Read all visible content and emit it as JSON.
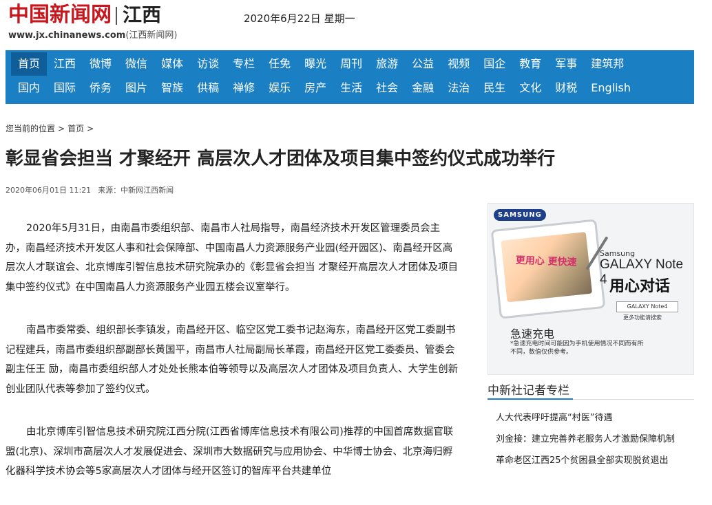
{
  "header": {
    "logo_text": "中国新闻网",
    "region": "江西",
    "url_domain": "www.jx.chinanews.com",
    "url_suffix": "(江西新闻网)",
    "date": "2020年6月22日",
    "weekday": "星期一"
  },
  "nav": {
    "row1": [
      "首页",
      "江西",
      "微博",
      "微信",
      "媒体",
      "访谈",
      "专栏",
      "任免",
      "曝光",
      "周刊",
      "旅游",
      "公益",
      "视频",
      "国企",
      "教育",
      "军事",
      "建筑邦"
    ],
    "row2": [
      "国内",
      "国际",
      "侨务",
      "图片",
      "智族",
      "供稿",
      "禅修",
      "娱乐",
      "房产",
      "生活",
      "社会",
      "金融",
      "法治",
      "民生",
      "文化",
      "财税",
      "English"
    ],
    "active": "首页",
    "colors": {
      "bar": "#1b7fc4",
      "active": "#0f5d99"
    }
  },
  "breadcrumb": {
    "prefix": "您当前的位置",
    "sep": ">",
    "home": "首页",
    "sep2": ">"
  },
  "article": {
    "title": "彰显省会担当 才聚经开 高层次人才团体及项目集中签约仪式成功举行",
    "datetime": "2020年06月01日 11:21",
    "source": "来源：中新网江西新闻",
    "paragraphs": [
      "2020年5月31日，由南昌市委组织部、南昌市人社局指导，南昌经济技术开发区管理委员会主办，南昌经济技术开发区人事和社会保障部、中国南昌人力资源服务产业园(经开园区)、南昌经开区高层次人才联谊会、北京博库引智信息技术研究院承办的《彰显省会担当 才聚经开高层次人才团体及项目集中签约仪式》在中国南昌人力资源服务产业园五楼会议室举行。",
      "南昌市委常委、组织部长李镇发，南昌经开区、临空区党工委书记赵海东，南昌经开区党工委副书记程建兵，南昌市委组织部副部长黄国平，南昌市人社局副局长革霞，南昌经开区党工委委员、管委会副主任王 励，南昌市委组织部人才处处长熊本伯等领导以及高层次人才团体及项目负责人、大学生创新创业团队代表等参加了签约仪式。",
      "由北京博库引智信息技术研究院江西分院(江西省博库信息技术有限公司)推荐的中国首席数据官联盟(北京)、深圳市高层次人才发展促进会、深圳市大数据研究与应用协会、中华博士协会、北京海归孵化器科学技术协会等5家高层次人才团体与经开区签订的智库平台共建单位"
    ]
  },
  "ad": {
    "brand": "SAMSUNG",
    "screen_text": "更用心 更快速",
    "model_line1": "Samsung",
    "model_line2": "GALAXY Note 4",
    "slogan": "用心对话",
    "box_label": "GALAXY Note4",
    "box_sub": "更多功能请搜索",
    "headline": "急速充电",
    "note": "*急速充电时间可能因为手机使用情况不同而有所不同，数值仅供参考。"
  },
  "sidebar": {
    "column_title": "中新社记者专栏",
    "items": [
      "人大代表呼吁提高“村医”待遇",
      "刘金接：建立完善养老服务人才激励保障机制",
      "革命老区江西25个贫困县全部实现脱贫退出"
    ],
    "accent_color": "#1b7fc4"
  }
}
